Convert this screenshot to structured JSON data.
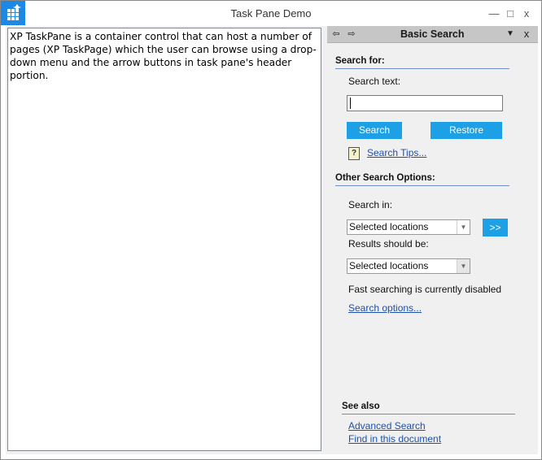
{
  "window": {
    "title": "Task Pane Demo",
    "minimize": "—",
    "maximize": "□",
    "close": "x"
  },
  "editor": {
    "text": "XP TaskPane is a container control that can host a number of pages (XP TaskPage) which the user can browse using a drop-down menu and the arrow buttons in task pane's header portion."
  },
  "pane": {
    "back_icon": "⇦",
    "forward_icon": "⇨",
    "title": "Basic Search",
    "menu_icon": "▼",
    "close_icon": "x",
    "search_for": {
      "heading": "Search for:",
      "search_text_label": "Search text:",
      "search_text_value": "",
      "search_button": "Search",
      "restore_button": "Restore",
      "tips_link": "Search Tips..."
    },
    "other_options": {
      "heading": "Other Search Options:",
      "search_in_label": "Search in:",
      "search_in_value": "Selected locations",
      "go_button": ">>",
      "results_label": "Results should be:",
      "results_value": "Selected locations",
      "fast_search_status": "Fast searching is currently disabled",
      "search_options_link": "Search options..."
    },
    "see_also": {
      "heading": "See also",
      "links": [
        "Advanced Search",
        "Find in this document"
      ]
    }
  },
  "colors": {
    "accent": "#1ea0e6",
    "link": "#1f4fa8",
    "heading_rule": "#6f8fc6",
    "app_icon": "#1e88e5"
  }
}
